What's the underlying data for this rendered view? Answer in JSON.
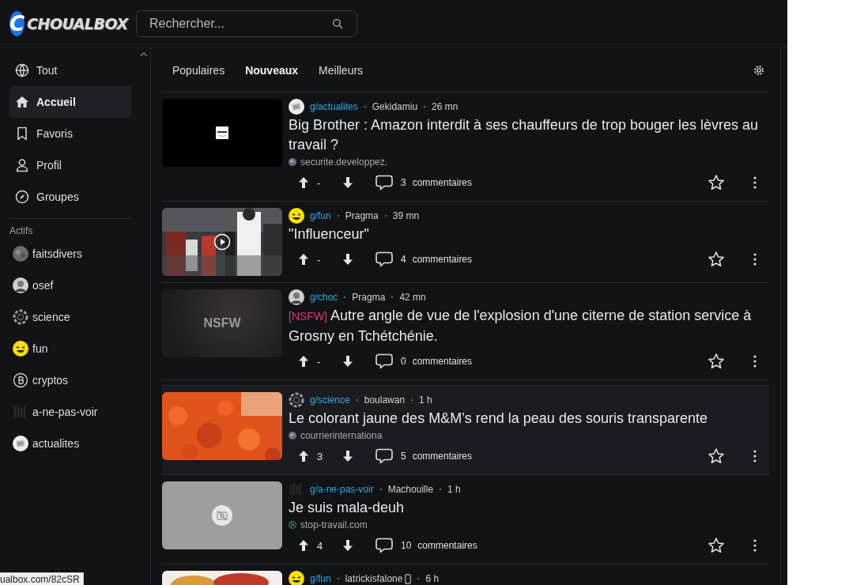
{
  "header": {
    "logo": {
      "letter": "C",
      "name": "CHOUALBOX"
    },
    "search": {
      "placeholder": "Rechercher..."
    }
  },
  "sidebar": {
    "items": [
      {
        "label": "Tout",
        "selected": false
      },
      {
        "label": "Accueil",
        "selected": true
      },
      {
        "label": "Favoris",
        "selected": false
      },
      {
        "label": "Profil",
        "selected": false
      },
      {
        "label": "Groupes",
        "selected": false
      }
    ],
    "groups_title": "Actifs",
    "groups": [
      {
        "label": "faitsdivers"
      },
      {
        "label": "osef"
      },
      {
        "label": "science"
      },
      {
        "label": "fun"
      },
      {
        "label": "cryptos"
      },
      {
        "label": "a-ne-pas-voir"
      },
      {
        "label": "actualites"
      }
    ]
  },
  "tabs": [
    {
      "label": "Populaires",
      "selected": false
    },
    {
      "label": "Nouveaux",
      "selected": true
    },
    {
      "label": "Meilleurs",
      "selected": false
    }
  ],
  "posts": [
    {
      "kind": "picture",
      "video": false,
      "highlighted": false,
      "group": "g/actualites",
      "author": "Gekidamiu",
      "mobile": false,
      "time": "26 mn",
      "title": "Big Brother : Amazon interdit à ses chauffeurs de trop bouger les lèvres au travail ?",
      "source": "securite.developpez.",
      "votes": "-",
      "comments": "3",
      "comments_label": "commentaires"
    },
    {
      "kind": "picture",
      "video": true,
      "highlighted": false,
      "group": "g/fun",
      "author": "Pragma",
      "mobile": false,
      "time": "39 mn",
      "title": "\"Influenceur\"",
      "votes": "-",
      "comments": "4",
      "comments_label": "commentaires"
    },
    {
      "kind": "nsfw",
      "thumb_text": "NSFW",
      "video": false,
      "highlighted": false,
      "group": "g/choc",
      "author": "Pragma",
      "mobile": false,
      "time": "42 mn",
      "tag": "[NSFW]",
      "title": "Autre angle de vue de l'explosion d'une citerne de station service à Grosny en Tchétchénie.",
      "votes": "-",
      "comments": "0",
      "comments_label": "commentaires"
    },
    {
      "kind": "picture",
      "video": false,
      "highlighted": true,
      "group": "g/science",
      "author": "boulawan",
      "mobile": false,
      "time": "1 h",
      "title": "Le colorant jaune des M&M’s rend la peau des souris transparente",
      "source": "courrierinternationa",
      "votes": "3",
      "comments": "5",
      "comments_label": "commentaires"
    },
    {
      "kind": "no-image",
      "video": false,
      "highlighted": false,
      "group": "g/a-ne-pas-voir",
      "author": "Machouille",
      "mobile": false,
      "time": "1 h",
      "title": "Je suis mala-deuh",
      "source": "stop-travail.com",
      "votes": "4",
      "comments": "10",
      "comments_label": "commentaires"
    },
    {
      "kind": "picture",
      "video": false,
      "highlighted": false,
      "group": "g/fun",
      "author": "latrickisfalone",
      "mobile": true,
      "time": "6 h"
    }
  ],
  "status_bar": {
    "url": "ualbox.com/82cSR"
  }
}
